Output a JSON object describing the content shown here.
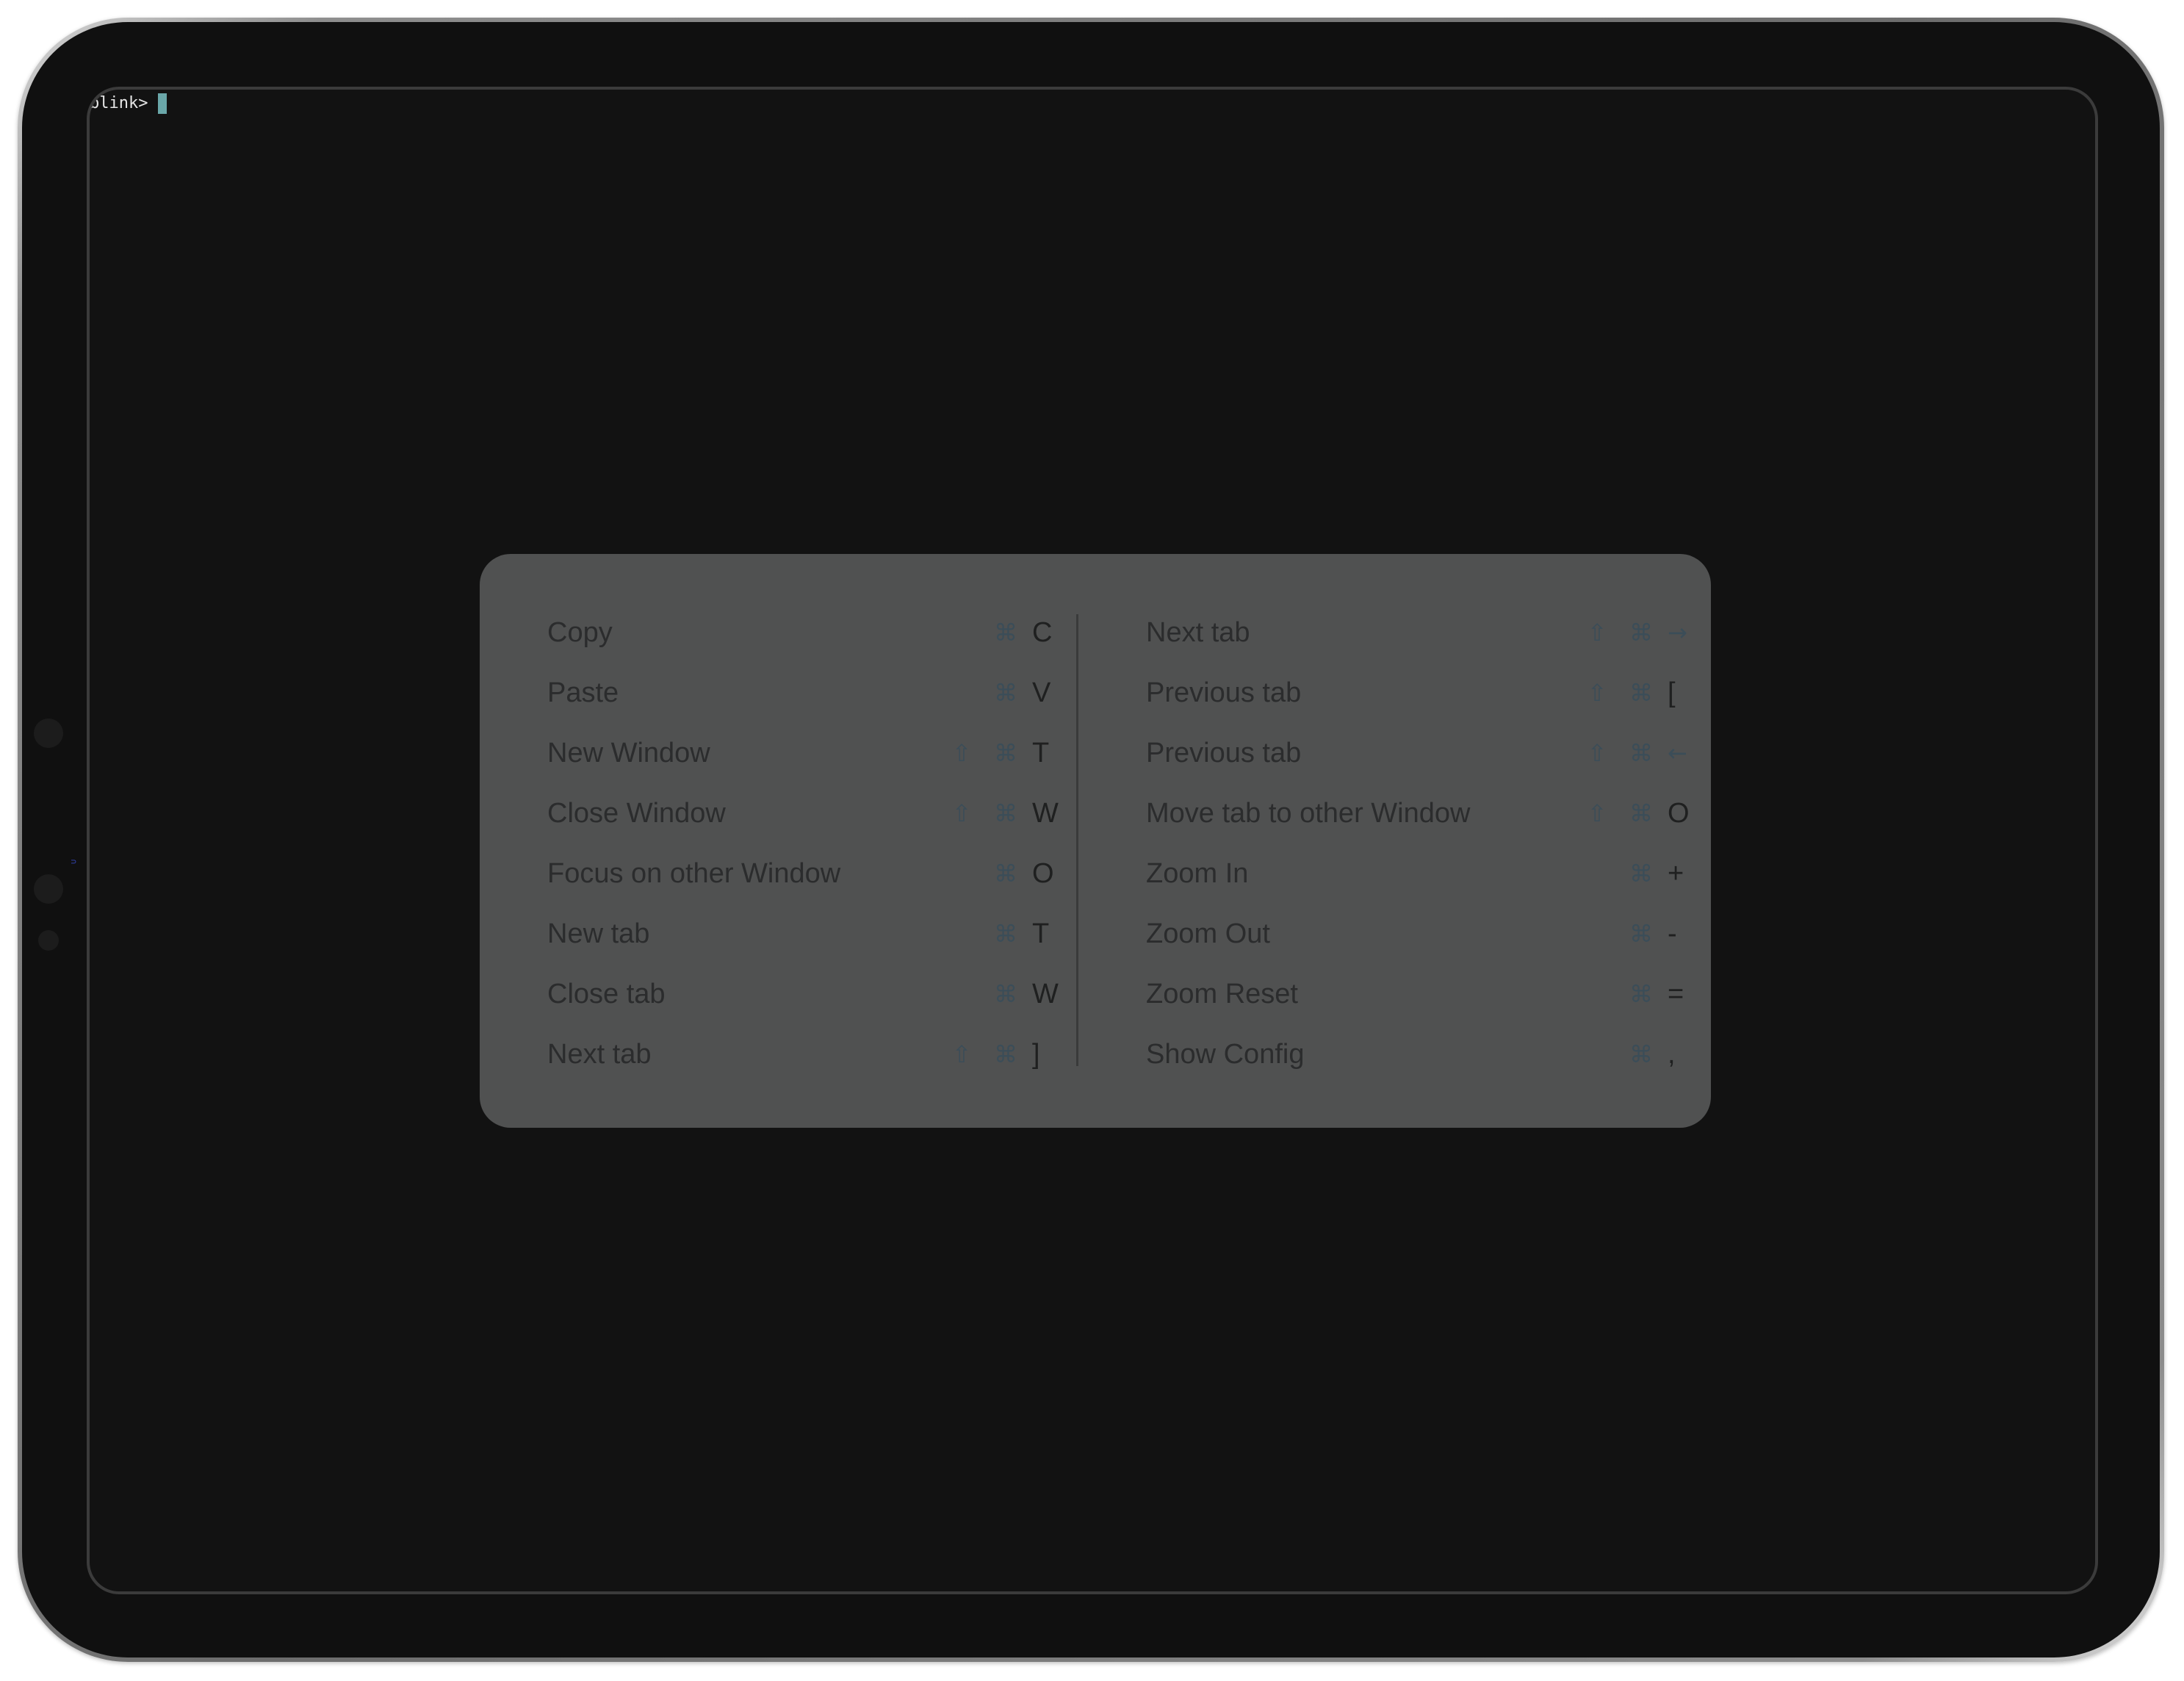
{
  "terminal": {
    "prompt": "blink>"
  },
  "shortcuts": {
    "left": [
      {
        "label": "Copy",
        "shift": "",
        "cmd": "⌘",
        "key": "C"
      },
      {
        "label": "Paste",
        "shift": "",
        "cmd": "⌘",
        "key": "V"
      },
      {
        "label": "New Window",
        "shift": "⇧",
        "cmd": "⌘",
        "key": "T"
      },
      {
        "label": "Close Window",
        "shift": "⇧",
        "cmd": "⌘",
        "key": "W"
      },
      {
        "label": "Focus on other Window",
        "shift": "",
        "cmd": "⌘",
        "key": "O"
      },
      {
        "label": "New tab",
        "shift": "",
        "cmd": "⌘",
        "key": "T"
      },
      {
        "label": "Close tab",
        "shift": "",
        "cmd": "⌘",
        "key": "W"
      },
      {
        "label": "Next tab",
        "shift": "⇧",
        "cmd": "⌘",
        "key": "]"
      }
    ],
    "right": [
      {
        "label": "Next tab",
        "shift": "⇧",
        "cmd": "⌘",
        "key": "→"
      },
      {
        "label": "Previous tab",
        "shift": "⇧",
        "cmd": "⌘",
        "key": "["
      },
      {
        "label": "Previous tab",
        "shift": "⇧",
        "cmd": "⌘",
        "key": "←"
      },
      {
        "label": "Move tab to other Window",
        "shift": "⇧",
        "cmd": "⌘",
        "key": "O"
      },
      {
        "label": "Zoom In",
        "shift": "",
        "cmd": "⌘",
        "key": "+"
      },
      {
        "label": "Zoom Out",
        "shift": "",
        "cmd": "⌘",
        "key": "-"
      },
      {
        "label": "Zoom Reset",
        "shift": "",
        "cmd": "⌘",
        "key": "="
      },
      {
        "label": "Show Config",
        "shift": "",
        "cmd": "⌘",
        "key": ","
      }
    ]
  },
  "colors": {
    "screen_background": "#121212",
    "overlay_background": "#505151",
    "cursor": "#6aa7a9",
    "modifier_icons": "#3b4d58"
  }
}
